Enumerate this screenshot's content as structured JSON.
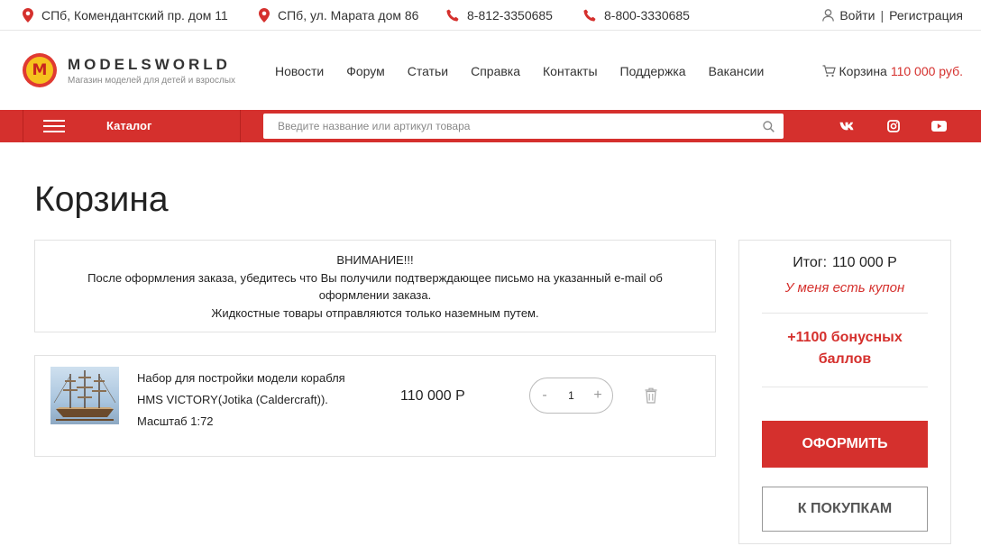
{
  "topbar": {
    "address1": "СПб, Комендантский пр. дом 11",
    "address2": "СПб, ул. Марата дом 86",
    "phone1": "8-812-3350685",
    "phone2": "8-800-3330685",
    "login": "Войти",
    "separator": "|",
    "register": "Регистрация"
  },
  "header": {
    "logo_letter": "M",
    "logo_name": "MODELSWORLD",
    "logo_tagline": "Магазин моделей для детей и взрослых",
    "nav": [
      "Новости",
      "Форум",
      "Статьи",
      "Справка",
      "Контакты",
      "Поддержка",
      "Вакансии"
    ],
    "cart_label": "Корзина",
    "cart_sum": "110 000 руб."
  },
  "redbar": {
    "catalog": "Каталог",
    "search_placeholder": "Введите название или артикул товара",
    "social": [
      "vk-icon",
      "instagram-icon",
      "youtube-icon"
    ]
  },
  "page": {
    "title": "Корзина"
  },
  "notice": {
    "line1": "ВНИМАНИЕ!!!",
    "line2": "После оформления заказа, убедитесь что Вы получили подтверждающее письмо на указанный e-mail об оформлении заказа.",
    "line3": "Жидкостные товары отправляются только наземным путем."
  },
  "item": {
    "name": "Набор для постройки модели корабля HMS VICTORY(Jotika (Caldercraft)). Масштаб 1:72",
    "price": "110 000 Р",
    "quantity": "1",
    "minus": "-",
    "plus": "+"
  },
  "summary": {
    "total_label": "Итог:",
    "total_value": "110 000 Р",
    "coupon": "У меня есть купон",
    "bonus": "+1100 бонусных баллов",
    "order_button": "ОФОРМИТЬ",
    "shop_button": "К ПОКУПКАМ"
  },
  "colors": {
    "accent": "#d5302d",
    "border": "#e2e2e2"
  }
}
